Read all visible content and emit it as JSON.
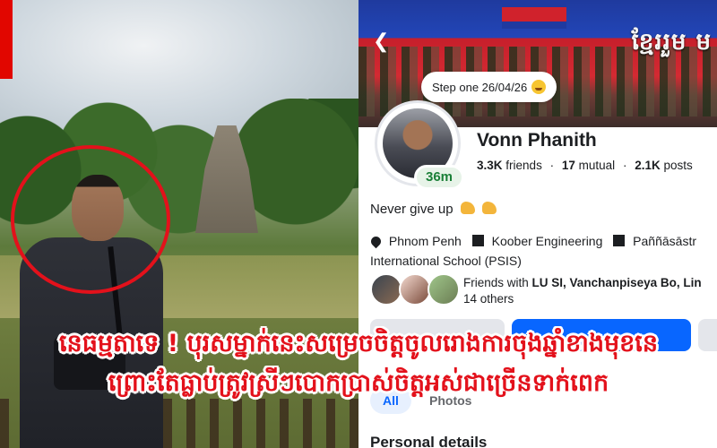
{
  "caption": {
    "line1": "នេធម្មតាទេ ! បុរសម្នាក់នេះសម្រេចចិត្តចូលរោងការចុងឆ្នាំខាងមុខនេ",
    "line2": "ព្រោះតែធ្លាប់ត្រូវស្រីៗបោកប្រាស់ចិត្តអស់ជាច្រើនទាក់ពេក"
  },
  "profile": {
    "cover_title": "ខ្មែររួម ម",
    "note": "Step one 26/04/26",
    "active_badge": "36m",
    "name": "Vonn Phanith",
    "stats": {
      "friends_count": "3.3K",
      "friends_label": "friends",
      "mutual_count": "17",
      "mutual_label": "mutual",
      "posts_count": "2.1K",
      "posts_label": "posts"
    },
    "bio": "Never give up",
    "details": {
      "location": "Phnom Penh",
      "work": "Koober Engineering",
      "school_line1": "Paññāsāstr",
      "school_line2": "International School (PSIS)"
    },
    "friends": {
      "prefix": "Friends with",
      "names": "LU SI, Vanchanpiseya Bo, Lin",
      "others": "14 others"
    },
    "tabs": {
      "all": "All",
      "photos": "Photos"
    },
    "section_title": "Personal details"
  },
  "colors": {
    "caption_red": "#e3111b",
    "facebook_blue": "#0866ff",
    "active_green": "#1a7f37"
  },
  "icons": [
    "back-arrow-icon",
    "location-pin-icon",
    "briefcase-icon",
    "school-icon",
    "muscle-emoji-icon",
    "heart-eyes-emoji-icon"
  ]
}
